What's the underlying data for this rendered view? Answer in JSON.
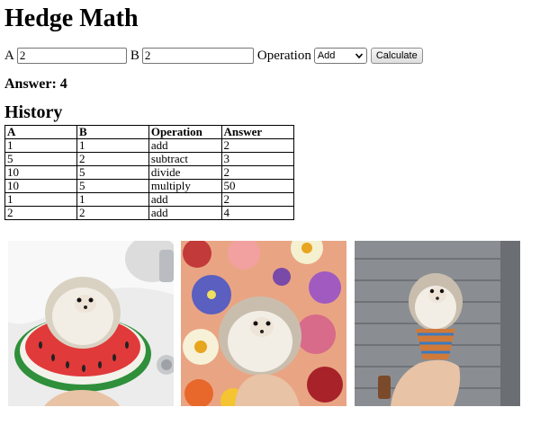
{
  "title": "Hedge Math",
  "form": {
    "a_label": "A",
    "a_value": "2",
    "b_label": "B",
    "b_value": "2",
    "operation_label": "Operation",
    "operation_selected": "Add",
    "calculate_label": "Calculate"
  },
  "answer_text": "Answer: 4",
  "history": {
    "heading": "History",
    "columns": [
      "A",
      "B",
      "Operation",
      "Answer"
    ],
    "rows": [
      [
        "1",
        "1",
        "add",
        "2"
      ],
      [
        "5",
        "2",
        "subtract",
        "3"
      ],
      [
        "10",
        "5",
        "divide",
        "2"
      ],
      [
        "10",
        "5",
        "multiply",
        "50"
      ],
      [
        "1",
        "1",
        "add",
        "2"
      ],
      [
        "2",
        "2",
        "add",
        "4"
      ]
    ]
  },
  "colors": {
    "watermelon_red": "#e03a3a",
    "watermelon_green": "#2f8f3a",
    "flower_background": "#e9a583",
    "siding_gray": "#8a8e93"
  }
}
